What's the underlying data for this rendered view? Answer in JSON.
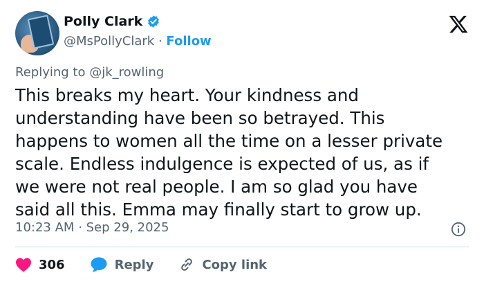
{
  "tweet": {
    "author_name": "Polly Clark",
    "author_handle": "@MsPollyClark",
    "separator": "·",
    "follow_label": "Follow",
    "replying_to_label": "Replying to",
    "replying_to_handle": "@jk_rowling",
    "body_lines": [
      "This breaks my heart. Your kindness and",
      "understanding have been so betrayed. This",
      "happens to women all the time on a lesser private",
      "scale. Endless indulgence is expected of us, as if",
      "we were not real people. I am so glad you have",
      "said all this. Emma may finally start to grow up."
    ],
    "time": "10:23 AM",
    "date": "Sep 29, 2025"
  },
  "actions": {
    "like_count": "306",
    "reply_label": "Reply",
    "copy_label": "Copy link"
  },
  "colors": {
    "accent": "#1d9bf0",
    "like": "#f91880",
    "muted": "#536471"
  },
  "icons": [
    "verified-badge-icon",
    "x-logo-icon",
    "info-icon",
    "heart-icon",
    "reply-bubble-icon",
    "link-icon"
  ]
}
